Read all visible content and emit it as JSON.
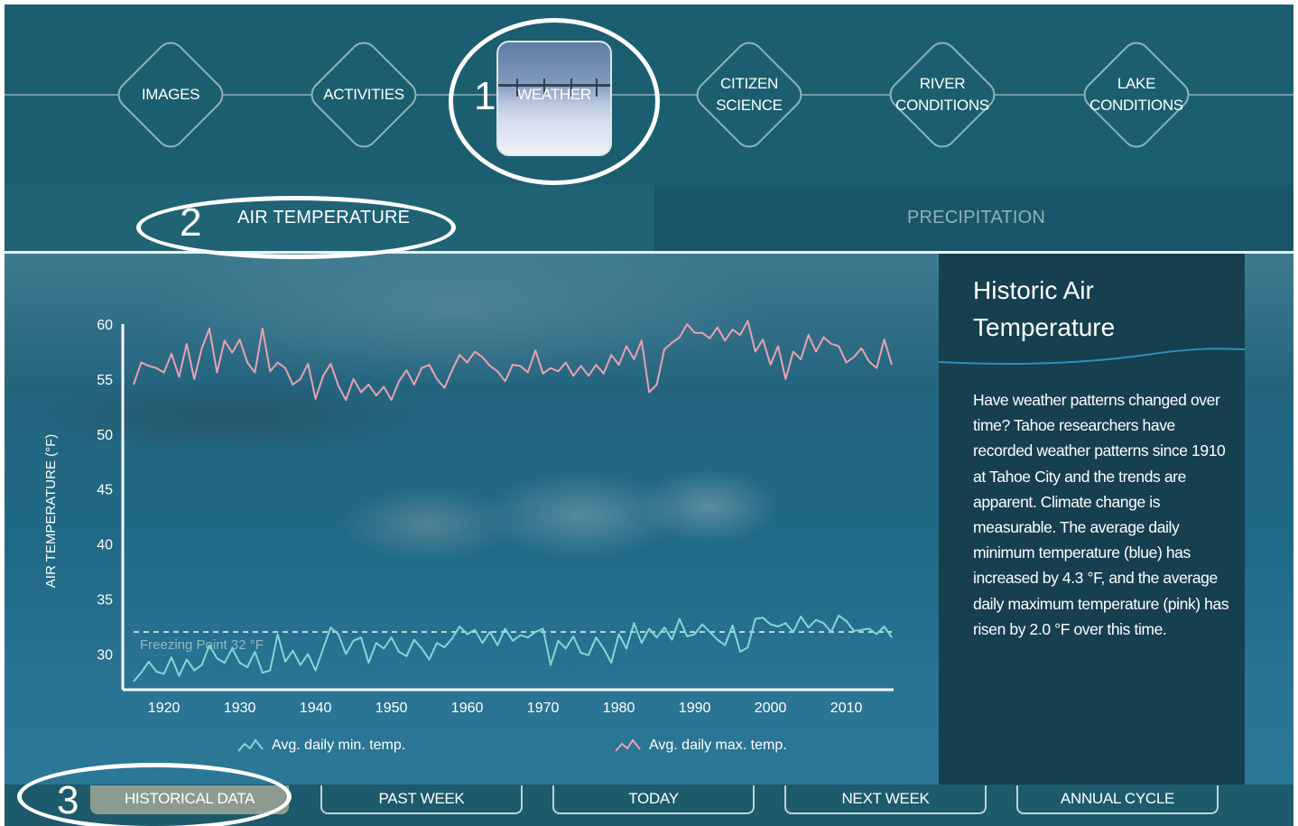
{
  "nav": {
    "items": [
      {
        "label": "IMAGES"
      },
      {
        "label": "ACTIVITIES"
      },
      {
        "label": "WEATHER"
      },
      {
        "label": "CITIZEN\nSCIENCE"
      },
      {
        "label": "RIVER\nCONDITIONS"
      },
      {
        "label": "LAKE\nCONDITIONS"
      }
    ],
    "active": "WEATHER"
  },
  "tabs": {
    "air": "AIR TEMPERATURE",
    "precip": "PRECIPITATION",
    "active": "AIR TEMPERATURE"
  },
  "callouts": [
    "1",
    "2",
    "3"
  ],
  "info": {
    "title": "Historic Air Temperature",
    "body": "Have weather patterns changed over time? Tahoe researchers have recorded weather patterns since 1910 at Tahoe City and the trends are apparent. Climate change is measurable. The average daily minimum temperature (blue) has increased by 4.3 °F, and the average daily maximum temperature (pink) has risen by 2.0 °F over this time."
  },
  "bottom": {
    "buttons": [
      "HISTORICAL DATA",
      "PAST WEEK",
      "TODAY",
      "NEXT WEEK",
      "ANNUAL CYCLE"
    ],
    "active": "HISTORICAL DATA"
  },
  "colors": {
    "max_series": "#e8a0b4",
    "min_series": "#7fd9d4",
    "panel": "#163f50",
    "active_button": "#8c9b8f"
  },
  "chart_data": {
    "type": "line",
    "ylabel": "AIR TEMPERATURE (°F)",
    "xlabel": "",
    "xlim": [
      1916,
      2016
    ],
    "ylim": [
      27,
      60
    ],
    "yticks": [
      60,
      55,
      50,
      45,
      40,
      35,
      30
    ],
    "xticks": [
      1920,
      1930,
      1940,
      1950,
      1960,
      1970,
      1980,
      1990,
      2000,
      2010
    ],
    "reference_line": {
      "value": 32,
      "label": "Freezing Point 32 °F"
    },
    "legend": [
      "Avg. daily min. temp.",
      "Avg. daily max. temp."
    ],
    "legend_position": "bottom",
    "series": [
      {
        "name": "Avg. daily max. temp.",
        "color": "#e8a0b4",
        "x": [
          1916,
          1917,
          1918,
          1919,
          1920,
          1921,
          1922,
          1923,
          1924,
          1925,
          1926,
          1927,
          1928,
          1929,
          1930,
          1931,
          1932,
          1933,
          1934,
          1935,
          1936,
          1937,
          1938,
          1939,
          1940,
          1941,
          1942,
          1943,
          1944,
          1945,
          1946,
          1947,
          1948,
          1949,
          1950,
          1951,
          1952,
          1953,
          1954,
          1955,
          1956,
          1957,
          1958,
          1959,
          1960,
          1961,
          1962,
          1963,
          1964,
          1965,
          1966,
          1967,
          1968,
          1969,
          1970,
          1971,
          1972,
          1973,
          1974,
          1975,
          1976,
          1977,
          1978,
          1979,
          1980,
          1981,
          1982,
          1983,
          1984,
          1985,
          1986,
          1987,
          1988,
          1989,
          1990,
          1991,
          1992,
          1993,
          1994,
          1995,
          1996,
          1997,
          1998,
          1999,
          2000,
          2001,
          2002,
          2003,
          2004,
          2005,
          2006,
          2007,
          2008,
          2009,
          2010,
          2011,
          2012,
          2013,
          2014,
          2015,
          2016
        ],
        "values": [
          54.5,
          56.5,
          56.2,
          56.0,
          55.6,
          57.3,
          55.2,
          58.2,
          55.0,
          57.8,
          59.6,
          55.6,
          58.5,
          57.4,
          58.6,
          56.5,
          55.6,
          59.6,
          55.7,
          56.5,
          56.0,
          54.5,
          55.0,
          56.4,
          53.2,
          55.3,
          56.4,
          54.4,
          53.1,
          55.0,
          53.8,
          54.5,
          53.5,
          54.3,
          53.1,
          54.8,
          55.8,
          54.5,
          56.0,
          56.3,
          55.0,
          54.2,
          55.8,
          57.2,
          56.5,
          57.5,
          57.0,
          56.2,
          55.7,
          54.8,
          56.3,
          56.2,
          55.6,
          57.6,
          55.5,
          56.0,
          55.7,
          56.5,
          55.3,
          56.2,
          55.3,
          56.3,
          55.5,
          57.2,
          56.3,
          58.0,
          56.8,
          58.5,
          53.8,
          54.5,
          57.7,
          58.3,
          58.8,
          60.0,
          59.2,
          59.2,
          58.7,
          59.7,
          58.5,
          59.5,
          59.0,
          60.3,
          57.5,
          58.6,
          56.3,
          58.0,
          55.0,
          57.5,
          56.8,
          59.0,
          57.5,
          58.8,
          58.2,
          58.0,
          56.5,
          57.0,
          57.8,
          56.6,
          56.0,
          58.6,
          56.3
        ]
      },
      {
        "name": "Avg. daily min. temp.",
        "color": "#7fd9d4",
        "x": [
          1916,
          1917,
          1918,
          1919,
          1920,
          1921,
          1922,
          1923,
          1924,
          1925,
          1926,
          1927,
          1928,
          1929,
          1930,
          1931,
          1932,
          1933,
          1934,
          1935,
          1936,
          1937,
          1938,
          1939,
          1940,
          1941,
          1942,
          1943,
          1944,
          1945,
          1946,
          1947,
          1948,
          1949,
          1950,
          1951,
          1952,
          1953,
          1954,
          1955,
          1956,
          1957,
          1958,
          1959,
          1960,
          1961,
          1962,
          1963,
          1964,
          1965,
          1966,
          1967,
          1968,
          1969,
          1970,
          1971,
          1972,
          1973,
          1974,
          1975,
          1976,
          1977,
          1978,
          1979,
          1980,
          1981,
          1982,
          1983,
          1984,
          1985,
          1986,
          1987,
          1988,
          1989,
          1990,
          1991,
          1992,
          1993,
          1994,
          1995,
          1996,
          1997,
          1998,
          1999,
          2000,
          2001,
          2002,
          2003,
          2004,
          2005,
          2006,
          2007,
          2008,
          2009,
          2010,
          2011,
          2012,
          2013,
          2014,
          2015,
          2016
        ],
        "values": [
          27.5,
          28.3,
          29.3,
          28.4,
          28.2,
          29.7,
          28.0,
          29.5,
          28.5,
          29.0,
          30.8,
          29.6,
          29.2,
          30.5,
          29.2,
          28.8,
          30.2,
          28.3,
          28.5,
          31.8,
          29.3,
          30.3,
          29.0,
          30.0,
          28.5,
          30.5,
          32.4,
          31.8,
          30.0,
          31.2,
          31.5,
          29.2,
          31.0,
          30.5,
          31.5,
          30.2,
          29.8,
          31.3,
          30.5,
          29.5,
          31.0,
          30.6,
          31.4,
          32.5,
          31.8,
          32.2,
          31.0,
          32.0,
          30.8,
          32.3,
          31.2,
          31.7,
          31.5,
          32.0,
          32.3,
          29.0,
          31.2,
          30.5,
          31.6,
          30.1,
          29.9,
          31.5,
          30.5,
          29.2,
          31.8,
          30.5,
          32.8,
          31.0,
          32.3,
          31.5,
          32.4,
          31.3,
          33.2,
          31.6,
          31.8,
          32.7,
          32.0,
          31.3,
          30.8,
          32.6,
          30.2,
          30.6,
          33.2,
          33.3,
          32.7,
          32.5,
          32.8,
          32.0,
          33.4,
          32.4,
          33.1,
          32.8,
          32.0,
          33.5,
          33.0,
          32.1,
          32.2,
          32.3,
          31.8,
          32.5,
          31.5
        ]
      }
    ]
  }
}
